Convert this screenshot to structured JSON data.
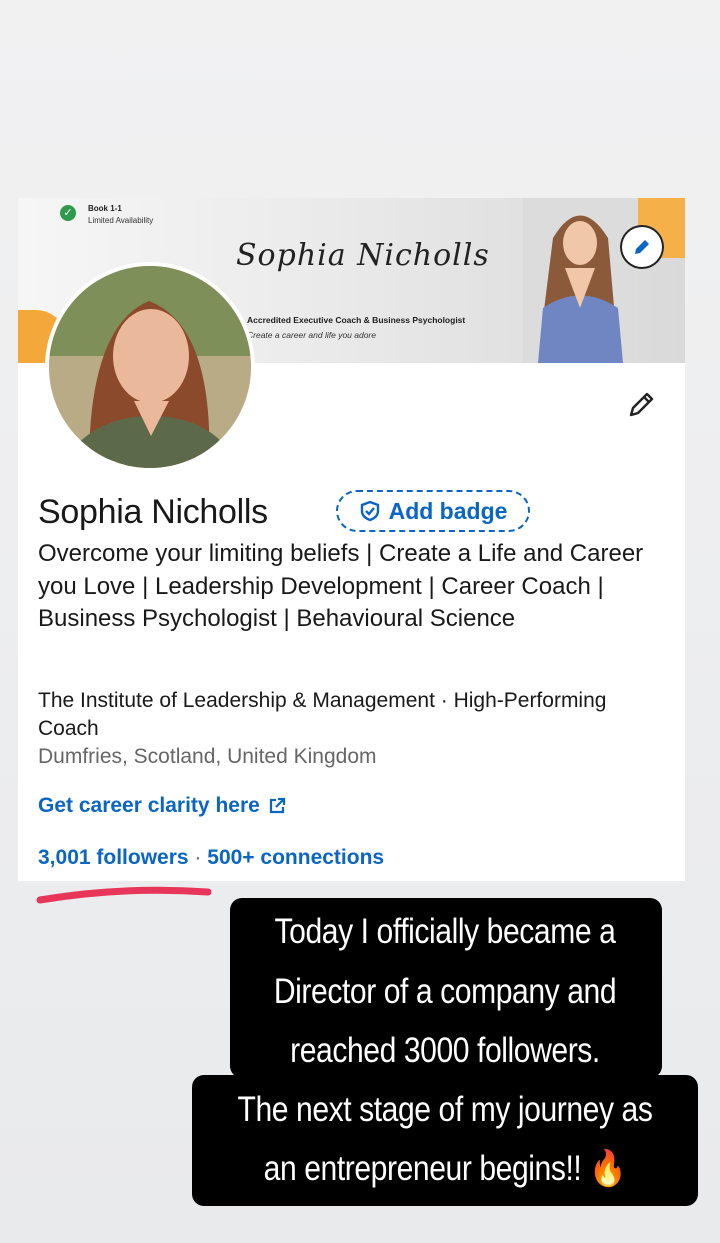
{
  "banner": {
    "booking_title": "Book 1-1",
    "booking_subtitle": "Limited Availability",
    "signature": "Sophia Nicholls",
    "tagline": "Accredited Executive Coach & Business Psychologist",
    "subtagline": "Create a career and life you adore"
  },
  "profile": {
    "name": "Sophia Nicholls",
    "badge_label": "Add badge",
    "headline": "Overcome your limiting beliefs | Create a Life and Career you Love | Leadership Development | Career Coach | Business Psychologist | Behavioural Science",
    "company": "The Institute of Leadership & Management · High-Performing Coach",
    "location": "Dumfries, Scotland, United Kingdom",
    "link_label": "Get career clarity here",
    "followers": "3,001 followers",
    "separator": "·",
    "connections": "500+ connections"
  },
  "story": {
    "line1": "Today I officially became a",
    "line2": "Director of a company and",
    "line3": "reached 3000 followers.",
    "line4": "The next stage of my journey as",
    "line5": "an entrepreneur begins!! 🔥"
  },
  "colors": {
    "linkedin_blue": "#0a66c2",
    "accent_orange": "#f5a83a",
    "underline_red": "#e8365a",
    "story_bg": "#000000"
  },
  "icons": {
    "check": "check-circle-icon",
    "edit": "pencil-icon",
    "verify": "shield-check-icon",
    "external": "external-link-icon"
  }
}
